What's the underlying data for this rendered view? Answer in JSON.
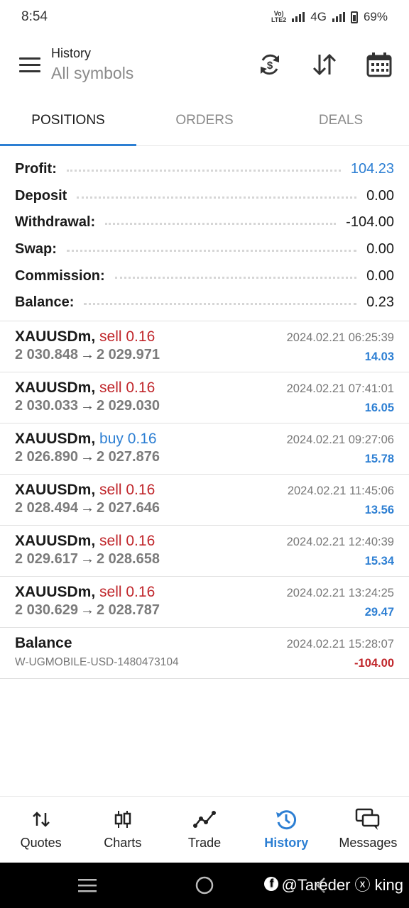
{
  "status_bar": {
    "time": "8:54",
    "network_label": "4G",
    "volte_label": "Vo)) LTE2",
    "battery": "69%"
  },
  "header": {
    "title": "History",
    "subtitle": "All symbols"
  },
  "tabs": [
    {
      "label": "POSITIONS",
      "active": true
    },
    {
      "label": "ORDERS",
      "active": false
    },
    {
      "label": "DEALS",
      "active": false
    }
  ],
  "summary": {
    "profit_label": "Profit:",
    "profit_value": "104.23",
    "deposit_label": "Deposit",
    "deposit_value": "0.00",
    "withdrawal_label": "Withdrawal:",
    "withdrawal_value": "-104.00",
    "swap_label": "Swap:",
    "swap_value": "0.00",
    "commission_label": "Commission:",
    "commission_value": "0.00",
    "balance_label": "Balance:",
    "balance_value": "0.23"
  },
  "deals": [
    {
      "symbol": "XAUUSDm,",
      "side": "sell 0.16",
      "side_type": "sell",
      "open": "2 030.848",
      "arrow": "→",
      "close": "2 029.971",
      "time": "2024.02.21 06:25:39",
      "profit": "14.03"
    },
    {
      "symbol": "XAUUSDm,",
      "side": "sell 0.16",
      "side_type": "sell",
      "open": "2 030.033",
      "arrow": "→",
      "close": "2 029.030",
      "time": "2024.02.21 07:41:01",
      "profit": "16.05"
    },
    {
      "symbol": "XAUUSDm,",
      "side": "buy 0.16",
      "side_type": "buy",
      "open": "2 026.890",
      "arrow": "→",
      "close": "2 027.876",
      "time": "2024.02.21 09:27:06",
      "profit": "15.78"
    },
    {
      "symbol": "XAUUSDm,",
      "side": "sell 0.16",
      "side_type": "sell",
      "open": "2 028.494",
      "arrow": "→",
      "close": "2 027.646",
      "time": "2024.02.21 11:45:06",
      "profit": "13.56"
    },
    {
      "symbol": "XAUUSDm,",
      "side": "sell 0.16",
      "side_type": "sell",
      "open": "2 029.617",
      "arrow": "→",
      "close": "2 028.658",
      "time": "2024.02.21 12:40:39",
      "profit": "15.34"
    },
    {
      "symbol": "XAUUSDm,",
      "side": "sell 0.16",
      "side_type": "sell",
      "open": "2 030.629",
      "arrow": "→",
      "close": "2 028.787",
      "time": "2024.02.21 13:24:25",
      "profit": "29.47"
    }
  ],
  "balance_op": {
    "title": "Balance",
    "comment": "W-UGMOBILE-USD-1480473104",
    "time": "2024.02.21 15:28:07",
    "amount": "-104.00"
  },
  "bottom_nav": [
    {
      "label": "Quotes",
      "icon": "quotes-arrows-icon",
      "active": false
    },
    {
      "label": "Charts",
      "icon": "candles-icon",
      "active": false
    },
    {
      "label": "Trade",
      "icon": "trade-line-icon",
      "active": false
    },
    {
      "label": "History",
      "icon": "history-clock-icon",
      "active": true
    },
    {
      "label": "Messages",
      "icon": "messages-icon",
      "active": false
    }
  ],
  "watermark": {
    "text": "@Tareder ⓧ king"
  },
  "colors": {
    "accent": "#2d7fd3",
    "sell": "#c0262b",
    "buy": "#2d7fd3"
  }
}
